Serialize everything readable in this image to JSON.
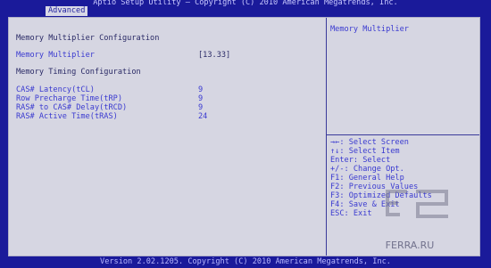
{
  "title": "Aptio Setup Utility – Copyright (C) 2010 American Megatrends, Inc.",
  "tabs": [
    {
      "label": "Advanced"
    }
  ],
  "main": {
    "section1": "Memory Multiplier Configuration",
    "multiplier": {
      "label": "Memory Multiplier",
      "value": "[13.33]"
    },
    "section2": "Memory Timing Configuration",
    "timings": [
      {
        "label": "CAS# Latency(tCL)",
        "value": "9"
      },
      {
        "label": "Row Precharge Time(tRP)",
        "value": "9"
      },
      {
        "label": "RAS# to CAS# Delay(tRCD)",
        "value": "9"
      },
      {
        "label": "RAS# Active Time(tRAS)",
        "value": "24"
      }
    ]
  },
  "help": {
    "title": "Memory Multiplier",
    "keys": [
      "→←: Select Screen",
      "↑↓: Select Item",
      "Enter: Select",
      "+/-: Change Opt.",
      "F1: General Help",
      "F2: Previous Values",
      "F3: Optimized Defaults",
      "F4: Save & Exit",
      "ESC: Exit"
    ]
  },
  "footer": "Version 2.02.1205. Copyright (C) 2010 American Megatrends, Inc.",
  "watermark": {
    "text": "FERRA.RU",
    "icon": "ferra-logo-icon"
  }
}
